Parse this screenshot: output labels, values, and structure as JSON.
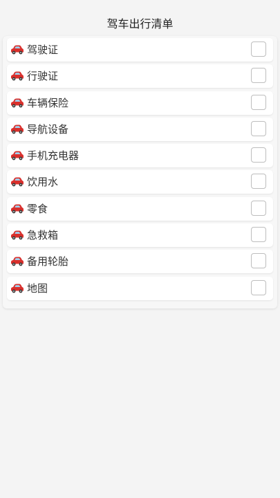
{
  "header": {
    "title": "驾车出行清单"
  },
  "checklist": {
    "icon": "car-icon",
    "items": [
      {
        "label": "驾驶证",
        "checked": false
      },
      {
        "label": "行驶证",
        "checked": false
      },
      {
        "label": "车辆保险",
        "checked": false
      },
      {
        "label": "导航设备",
        "checked": false
      },
      {
        "label": "手机充电器",
        "checked": false
      },
      {
        "label": "饮用水",
        "checked": false
      },
      {
        "label": "零食",
        "checked": false
      },
      {
        "label": "急救箱",
        "checked": false
      },
      {
        "label": "备用轮胎",
        "checked": false
      },
      {
        "label": "地图",
        "checked": false
      }
    ]
  },
  "colors": {
    "background": "#f4f4f4",
    "item_background": "#ffffff",
    "car_red": "#d9302c",
    "checkbox_border": "#bdbdbd"
  }
}
